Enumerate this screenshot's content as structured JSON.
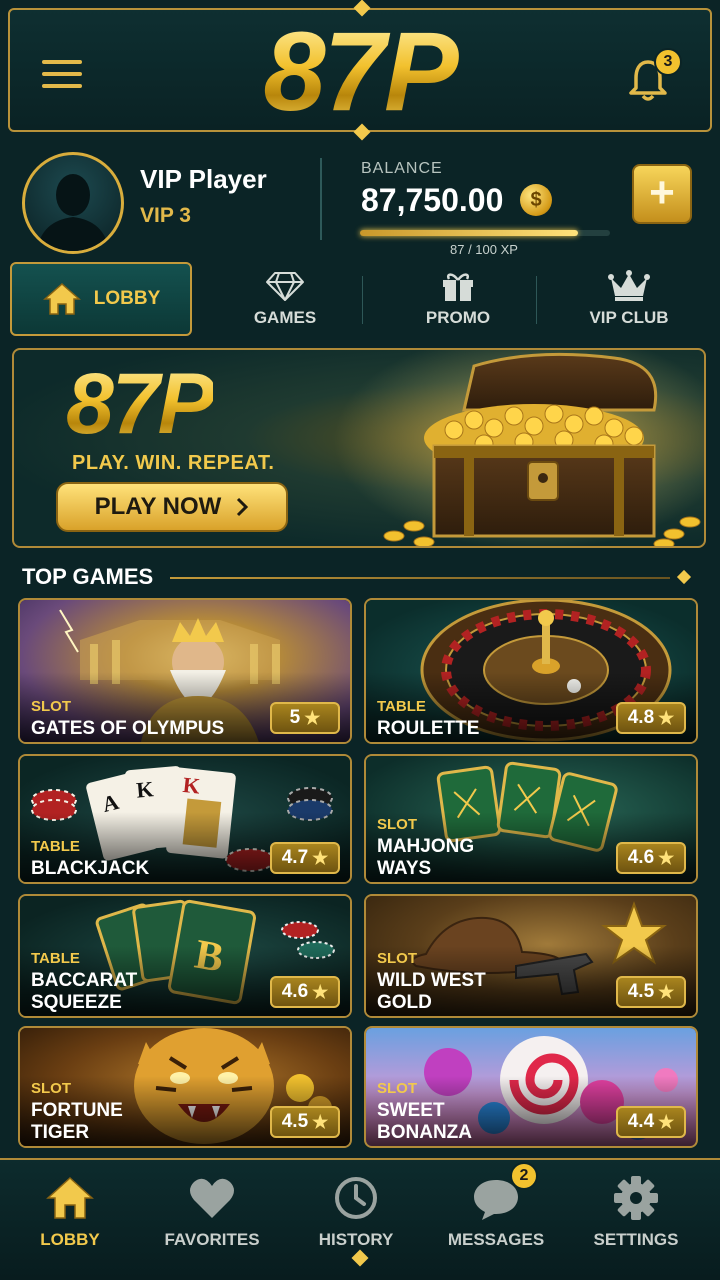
{
  "header": {
    "logo": "87P",
    "notification_count": "3"
  },
  "profile": {
    "name": "VIP Player",
    "vip_level": "VIP 3",
    "balance_label": "BALANCE",
    "balance_value": "87,750.00",
    "coin_symbol": "$",
    "add_label": "+",
    "xp_text": "87 / 100 XP",
    "xp_progress": 0.87
  },
  "tabs": [
    {
      "label": "LOBBY",
      "icon": "home-icon",
      "active": true
    },
    {
      "label": "GAMES",
      "icon": "diamond-icon",
      "active": false
    },
    {
      "label": "PROMO",
      "icon": "gift-icon",
      "active": false
    },
    {
      "label": "VIP CLUB",
      "icon": "crown-icon",
      "active": false
    }
  ],
  "banner": {
    "logo": "87P",
    "tagline": "PLAY. WIN. REPEAT.",
    "cta_label": "PLAY NOW",
    "cta_icon": "chevron-right-icon"
  },
  "section": {
    "title": "TOP GAMES"
  },
  "games": [
    {
      "category": "SLOT",
      "name": "GATES OF OLYMPUS",
      "rating": "5"
    },
    {
      "category": "TABLE",
      "name": "ROULETTE",
      "rating": "4.8"
    },
    {
      "category": "TABLE",
      "name": "BLACKJACK",
      "rating": "4.7"
    },
    {
      "category": "SLOT",
      "name_line1": "MAHJONG",
      "name_line2": "WAYS",
      "rating": "4.6"
    },
    {
      "category": "TABLE",
      "name_line1": "BACCARAT",
      "name_line2": "SQUEEZE",
      "rating": "4.6"
    },
    {
      "category": "SLOT",
      "name_line1": "WILD WEST",
      "name_line2": "GOLD",
      "rating": "4.5"
    },
    {
      "category": "SLOT",
      "name_line1": "FORTUNE",
      "name_line2": "TIGER",
      "rating": "4.5"
    },
    {
      "category": "SLOT",
      "name_line1": "SWEET",
      "name_line2": "BONANZA",
      "rating": "4.4"
    }
  ],
  "star_glyph": "★",
  "bottom_nav": [
    {
      "label": "LOBBY",
      "icon": "home-icon",
      "active": true
    },
    {
      "label": "FAVORITES",
      "icon": "heart-icon",
      "active": false
    },
    {
      "label": "HISTORY",
      "icon": "clock-icon",
      "active": false
    },
    {
      "label": "MESSAGES",
      "icon": "chat-icon",
      "active": false,
      "badge": "2"
    },
    {
      "label": "SETTINGS",
      "icon": "gear-icon",
      "active": false
    }
  ],
  "colors": {
    "background": "#0b2426",
    "gold": "#f2c94c",
    "border_gold": "#b08a38"
  }
}
